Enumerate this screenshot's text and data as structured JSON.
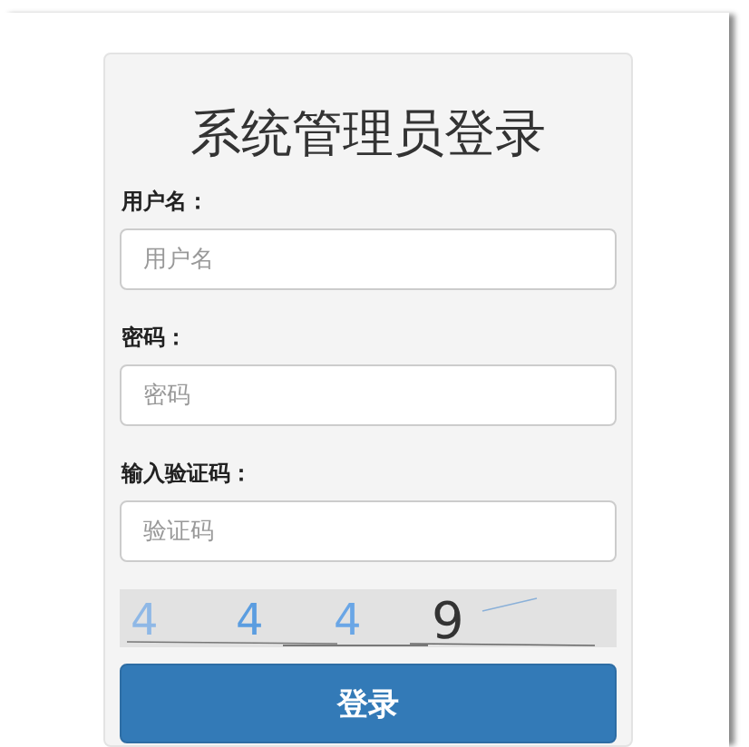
{
  "title": "系统管理员登录",
  "fields": [
    {
      "label": "用户名：",
      "placeholder": "用户名"
    },
    {
      "label": "密码：",
      "placeholder": "密码"
    },
    {
      "label": "输入验证码：",
      "placeholder": "验证码"
    }
  ],
  "captcha": {
    "characters": [
      {
        "text": "4",
        "color": "#8fb8e6"
      },
      {
        "text": "4",
        "color": "#5b9de0"
      },
      {
        "text": "4",
        "color": "#6aa6e6"
      },
      {
        "text": "9",
        "color": "#333333"
      }
    ]
  },
  "button": "登录"
}
